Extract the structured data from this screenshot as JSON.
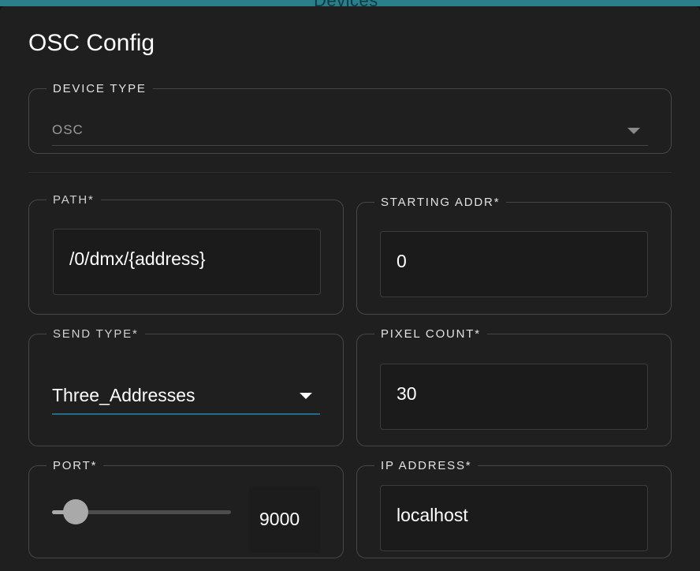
{
  "backdrop": {
    "title": "Devices"
  },
  "dialog": {
    "title": "OSC Config"
  },
  "device_type": {
    "legend": "DEVICE TYPE",
    "value": "OSC"
  },
  "fields": {
    "path": {
      "legend": "PATH*",
      "value": "/0/dmx/{address}"
    },
    "starting_addr": {
      "legend": "STARTING ADDR*",
      "value": "0"
    },
    "send_type": {
      "legend": "SEND TYPE*",
      "value": "Three_Addresses"
    },
    "pixel_count": {
      "legend": "PIXEL COUNT*",
      "value": "30"
    },
    "port": {
      "legend": "PORT*",
      "value": "9000",
      "slider_fraction": 0.13
    },
    "ip_address": {
      "legend": "IP ADDRESS*",
      "value": "localhost"
    }
  },
  "colors": {
    "accent": "#1f6d8a",
    "header_bar": "#2a7f8a",
    "dialog_bg": "#1f1f20"
  },
  "icons": {
    "select_caret": "caret-down-icon"
  }
}
